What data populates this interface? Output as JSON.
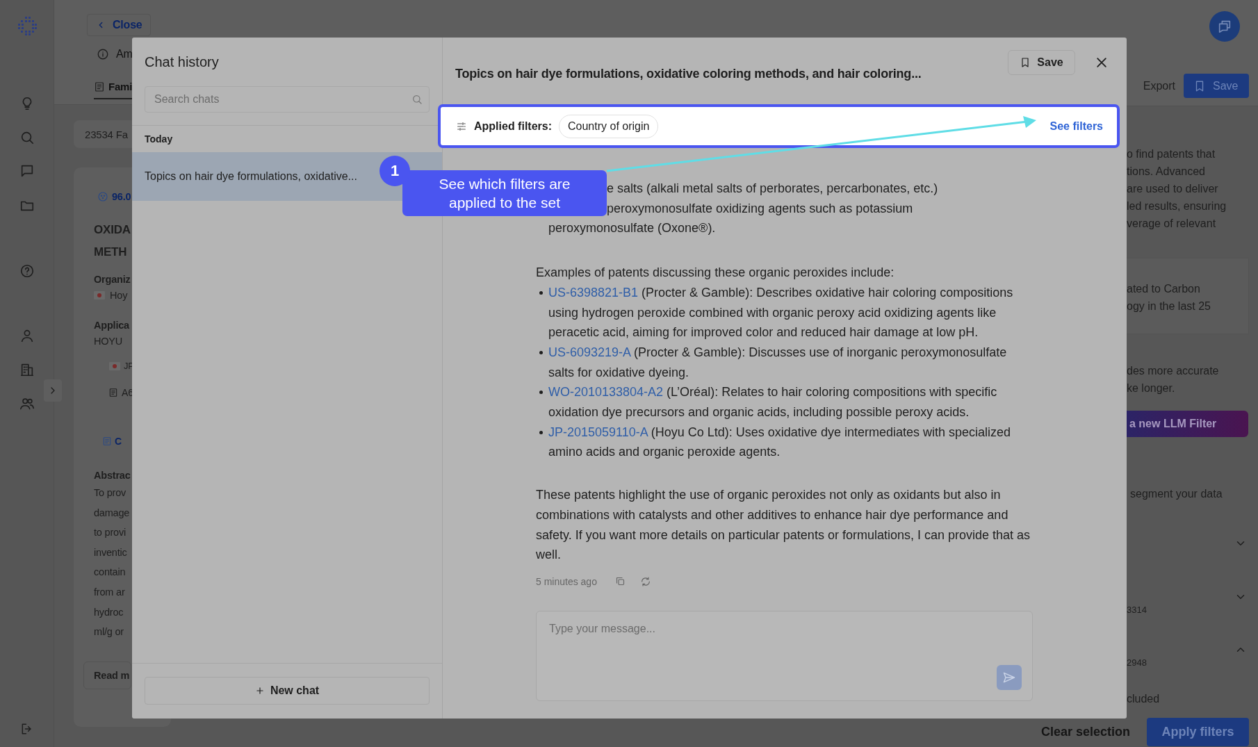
{
  "background_left": {
    "close_button": "Close",
    "title": "Am",
    "tab": "Fami",
    "count": "23534 Fa",
    "score": "96.0",
    "heading_lines": [
      "OXIDA",
      "METH"
    ],
    "organization_label": "Organiz",
    "organization_value": "Hoy",
    "applicant_label": "Applica",
    "applicant_value": "HOYU",
    "country": "JP",
    "class_code": "A6",
    "document_button": "C",
    "abstract_label": "Abstrac",
    "abstract_lines": [
      "To prov",
      "damage",
      "to provi",
      "inventic",
      "contain",
      "from ar",
      "hydroc",
      "ml/g or"
    ],
    "read_more": "Read m"
  },
  "background_right": {
    "export_button": "Export",
    "save_button": "Save",
    "intro_lines": [
      "o find patents that",
      "tions. Advanced",
      "are used to deliver",
      "led results, ensuring",
      "verage of relevant"
    ],
    "example_lines": [
      "ated to Carbon",
      "ogy in the last 25"
    ],
    "note_lines": [
      "des more accurate",
      "ke longer."
    ],
    "llm_button": "a new LLM Filter",
    "segment_text": "segment your data",
    "sections": [
      {
        "expanded": false
      },
      {
        "count": "3314",
        "expanded": false
      },
      {
        "count": "2948",
        "expanded": true
      }
    ],
    "excluded_text": "cluded",
    "clear_button": "Clear selection",
    "apply_button": "Apply filters"
  },
  "chat_history": {
    "title": "Chat history",
    "search": {
      "placeholder": "Search chats"
    },
    "groups": [
      {
        "label": "Today",
        "chats": [
          {
            "title": "Topics on hair dye formulations, oxidative...",
            "selected": true
          }
        ]
      }
    ],
    "new_chat_button": "New chat"
  },
  "chat": {
    "title": "Topics on hair dye formulations, oxidative coloring methods, and hair coloring...",
    "save_button": "Save",
    "filters": {
      "label": "Applied filters:",
      "chips": [
        "Country of origin"
      ],
      "see_filters": "See filters"
    },
    "partial_lines": [
      "e salts (alkali metal salts of perborates, percarbonates, etc.)",
      "peroxymonosulfate oxidizing agents such as potassium",
      "peroxymonosulfate (Oxone®)."
    ],
    "intro": "Examples of patents discussing these organic peroxides include:",
    "examples": [
      {
        "link": "US-6398821-B1",
        "text": " (Procter & Gamble): Describes oxidative hair coloring compositions using hydrogen peroxide combined with organic peroxy acid oxidizing agents like peracetic acid, aiming for improved color and reduced hair damage at low pH."
      },
      {
        "link": "US-6093219-A",
        "text": " (Procter & Gamble): Discusses use of inorganic peroxymonosulfate salts for oxidative dyeing."
      },
      {
        "link": "WO-2010133804-A2",
        "text": " (L’Oréal): Relates to hair coloring compositions with specific oxidation dye precursors and organic acids, including possible peroxy acids."
      },
      {
        "link": "JP-2015059110-A",
        "text": " (Hoyu Co Ltd): Uses oxidative dye intermediates with specialized amino acids and organic peroxide agents."
      }
    ],
    "conclusion": "These patents highlight the use of organic peroxides not only as oxidants but also in combinations with catalysts and other additives to enhance hair dye performance and safety. If you want more details on particular patents or formulations, I can provide that as well.",
    "timestamp": "5 minutes ago",
    "message": {
      "placeholder": "Type your message..."
    }
  },
  "tour": {
    "step": "1",
    "text": "See which filters are applied to the set"
  }
}
